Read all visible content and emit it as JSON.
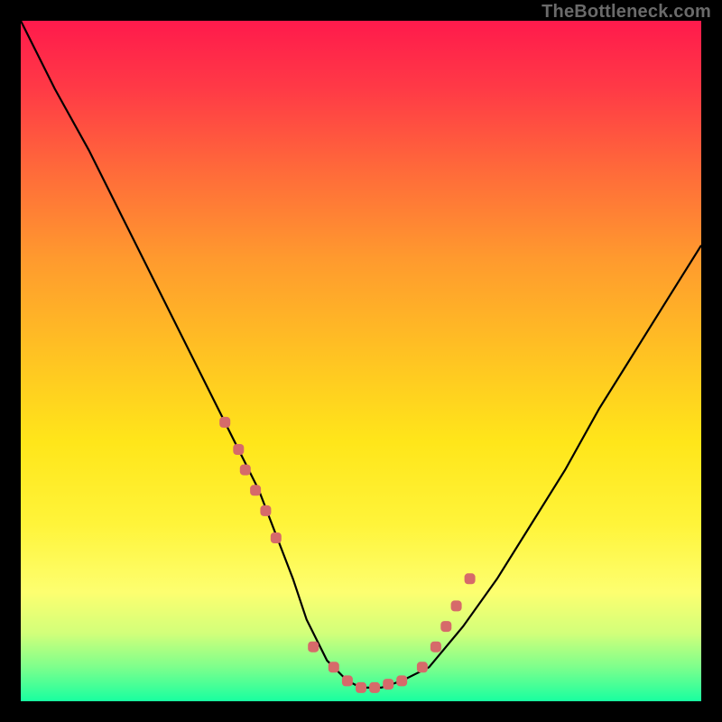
{
  "watermark": "TheBottleneck.com",
  "chart_data": {
    "type": "line",
    "title": "",
    "xlabel": "",
    "ylabel": "",
    "xlim": [
      0,
      100
    ],
    "ylim": [
      0,
      100
    ],
    "grid": false,
    "legend": false,
    "series": [
      {
        "name": "bottleneck-curve",
        "x": [
          0,
          5,
          10,
          15,
          20,
          25,
          30,
          35,
          40,
          42,
          45,
          48,
          50,
          53,
          56,
          60,
          65,
          70,
          75,
          80,
          85,
          90,
          95,
          100
        ],
        "y": [
          100,
          90,
          81,
          71,
          61,
          51,
          41,
          31,
          18,
          12,
          6,
          3,
          2,
          2,
          3,
          5,
          11,
          18,
          26,
          34,
          43,
          51,
          59,
          67
        ]
      }
    ],
    "markers": {
      "name": "highlighted-points",
      "x": [
        30,
        32,
        33,
        34.5,
        36,
        37.5,
        43,
        46,
        48,
        50,
        52,
        54,
        56,
        59,
        61,
        62.5,
        64,
        66
      ],
      "y": [
        41,
        37,
        34,
        31,
        28,
        24,
        8,
        5,
        3,
        2,
        2,
        2.5,
        3,
        5,
        8,
        11,
        14,
        18
      ],
      "color": "#d66a6a"
    },
    "background_gradient": {
      "stops": [
        {
          "pos": 0.0,
          "color": "#ff1a4c"
        },
        {
          "pos": 0.5,
          "color": "#ffc522"
        },
        {
          "pos": 0.84,
          "color": "#fdff70"
        },
        {
          "pos": 1.0,
          "color": "#18ffa0"
        }
      ]
    }
  }
}
